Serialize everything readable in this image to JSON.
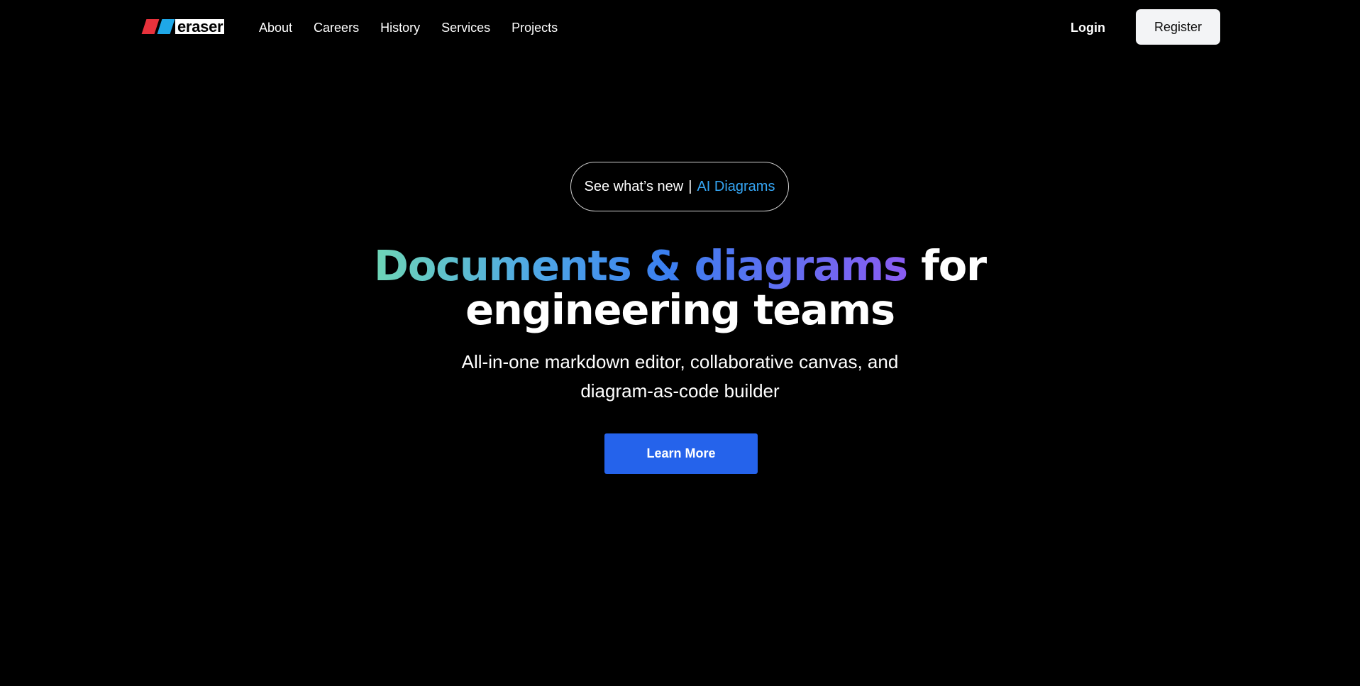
{
  "header": {
    "logo": {
      "text": "eraser",
      "icon": "eraser-logo-icon",
      "colors": {
        "red": "#e8323c",
        "blue": "#1fa8e8"
      }
    },
    "nav": [
      {
        "label": "About"
      },
      {
        "label": "Careers"
      },
      {
        "label": "History"
      },
      {
        "label": "Services"
      },
      {
        "label": "Projects"
      }
    ],
    "login_label": "Login",
    "register_label": "Register"
  },
  "hero": {
    "announcement": {
      "prefix": "See what’s new",
      "separator": "|",
      "link": "AI Diagrams"
    },
    "headline": {
      "gradient_part": "Documents & diagrams",
      "line1_rest": " for",
      "line2": "engineering teams"
    },
    "subtitle": {
      "line1": "All-in-one markdown editor, collaborative canvas, and",
      "line2": "diagram-as-code builder"
    },
    "cta_label": "Learn More"
  },
  "colors": {
    "background": "#000000",
    "accent": "#2563eb",
    "link_accent": "#35a6f5",
    "gradient": [
      "#6ed6b6",
      "#4fa8e6",
      "#3b7ff0",
      "#8a5cf2"
    ]
  }
}
